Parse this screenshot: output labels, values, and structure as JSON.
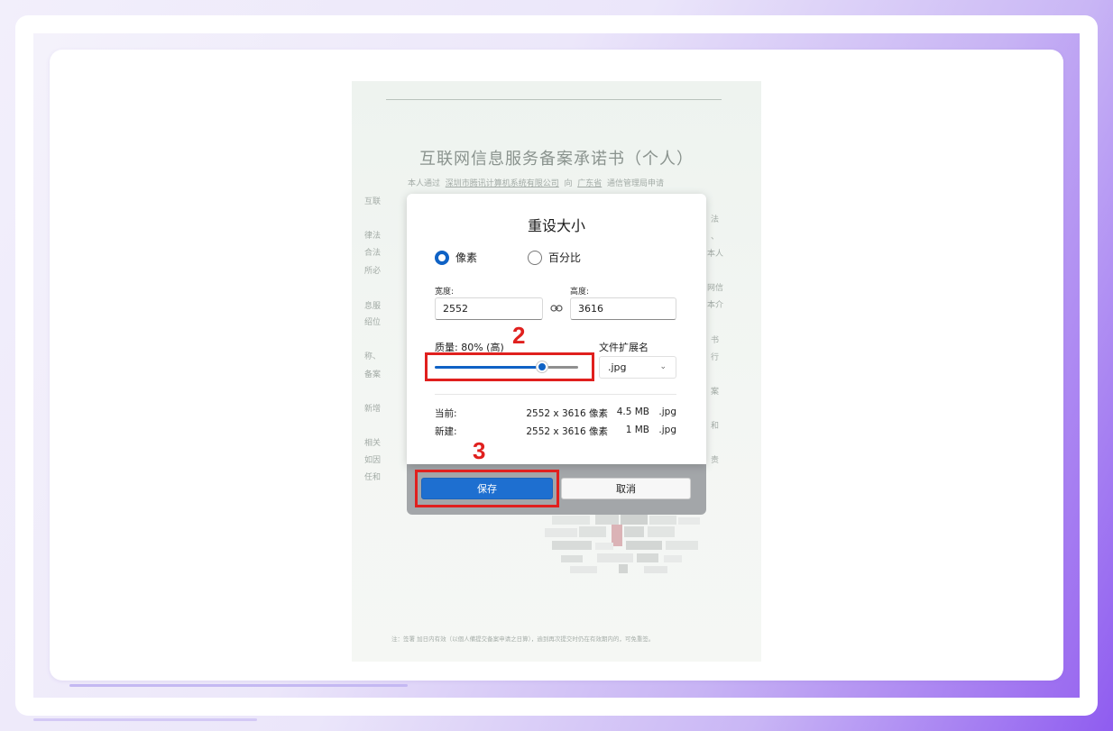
{
  "document": {
    "title": "互联网信息服务备案承诺书（个人）",
    "line1_prefix": "本人通过",
    "line1_company": "深圳市腾讯计算机系统有限公司",
    "line1_mid": "向",
    "line1_province": "广东省",
    "line1_suffix": "通信管理局申请",
    "left_fragments": [
      "互联",
      "律法",
      "合法",
      "所必",
      "息服",
      "绍位",
      "称、",
      "备案",
      "新增",
      "相关",
      "如因",
      "任和"
    ],
    "right_fragments": [
      "法",
      "、",
      "本人",
      "网信",
      "本介",
      "书",
      "行",
      "案",
      "和",
      "责"
    ],
    "footnote": "注：签署 加日内有效（以個人備提交备案申请之日算），逾到再次提交时仍在有效期内的，可免重签。"
  },
  "dialog": {
    "title": "重设大小",
    "radio_pixels": "像素",
    "radio_percent": "百分比",
    "width_label": "宽度:",
    "width_value": "2552",
    "height_label": "高度:",
    "height_value": "3616",
    "quality_label": "质量: 80% (高)",
    "quality_value": 0.8,
    "ext_label": "文件扩展名",
    "ext_value": ".jpg",
    "current_label": "当前:",
    "current_dims": "2552 x 3616 像素",
    "current_size": "4.5 MB",
    "current_ext": ".jpg",
    "new_label": "新建:",
    "new_dims": "2552 x 3616 像素",
    "new_size": "1 MB",
    "new_ext": ".jpg",
    "save_label": "保存",
    "cancel_label": "取消"
  },
  "annotations": {
    "step2": "2",
    "step3": "3"
  },
  "colors": {
    "accent_blue": "#0f62c5",
    "annotation_red": "#e0201e"
  }
}
